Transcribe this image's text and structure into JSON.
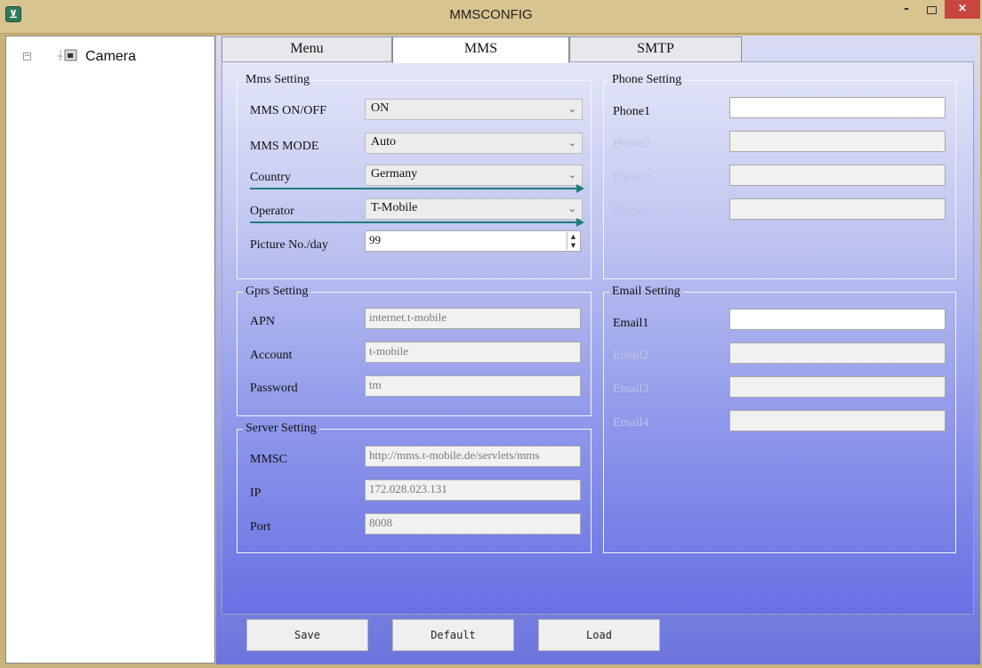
{
  "window": {
    "title": "MMSCONFIG",
    "minimize": "-",
    "close": "×"
  },
  "tree": {
    "expander": "⊟",
    "root_label": "Camera"
  },
  "tabs": [
    {
      "label": "Menu"
    },
    {
      "label": "MMS"
    },
    {
      "label": "SMTP"
    }
  ],
  "mms_setting": {
    "legend": "Mms Setting",
    "mms_onoff": {
      "label": "MMS ON/OFF",
      "value": "ON"
    },
    "mms_mode": {
      "label": "MMS MODE",
      "value": "Auto"
    },
    "country": {
      "label": "Country",
      "value": "Germany"
    },
    "operator": {
      "label": "Operator",
      "value": "T-Mobile"
    },
    "picture_per_day": {
      "label": "Picture No./day",
      "value": "99"
    }
  },
  "phone_setting": {
    "legend": "Phone Setting",
    "phones": [
      {
        "label": "Phone1",
        "value": ""
      },
      {
        "label": "Phone2",
        "value": ""
      },
      {
        "label": "Phone3",
        "value": ""
      },
      {
        "label": "Phone4",
        "value": ""
      }
    ]
  },
  "gprs_setting": {
    "legend": "Gprs Setting",
    "apn": {
      "label": "APN",
      "value": "internet.t-mobile"
    },
    "account": {
      "label": "Account",
      "value": "t-mobile"
    },
    "password": {
      "label": "Password",
      "value": "tm"
    }
  },
  "server_setting": {
    "legend": "Server Setting",
    "mmsc": {
      "label": "MMSC",
      "value": "http://mms.t-mobile.de/servlets/mms"
    },
    "ip": {
      "label": "IP",
      "value": "172.028.023.131"
    },
    "port": {
      "label": "Port",
      "value": "8008"
    }
  },
  "email_setting": {
    "legend": "Email Setting",
    "emails": [
      {
        "label": "Email1",
        "value": ""
      },
      {
        "label": "Email2",
        "value": ""
      },
      {
        "label": "Email3",
        "value": ""
      },
      {
        "label": "Email4",
        "value": ""
      }
    ]
  },
  "buttons": {
    "save": "Save",
    "default": "Default",
    "load": "Load"
  },
  "icons": {
    "chevron": "⌄",
    "spin_up": "▲",
    "spin_down": "▼"
  },
  "colors": {
    "accent_arrow": "#1e7f7a",
    "close_button": "#c7463e"
  }
}
